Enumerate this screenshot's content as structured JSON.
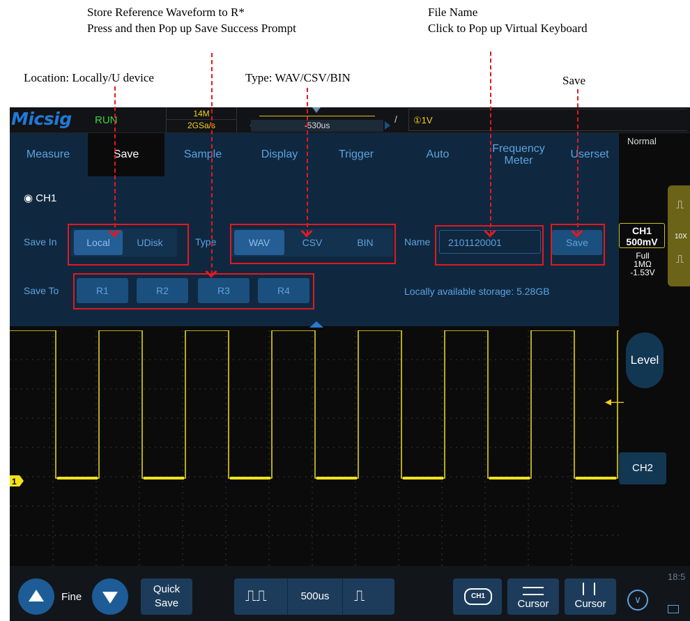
{
  "annotations": {
    "store_ref_line1": "Store Reference Waveform to R*",
    "store_ref_line2": "Press and then Pop up Save Success Prompt",
    "file_name_line1": "File Name",
    "file_name_line2": "Click to Pop up Virtual Keyboard",
    "location": "Location: Locally/U device",
    "type": "Type: WAV/CSV/BIN",
    "save": "Save"
  },
  "topbar": {
    "logo": "Micsig",
    "run_status": "RUN",
    "memory_depth": "14M",
    "sample_rate": "2GSa/s",
    "timebase_offset": "-530us",
    "trigger_level": "①1V"
  },
  "menu": {
    "items": [
      "Measure",
      "Save",
      "Sample",
      "Display",
      "Trigger",
      "Auto"
    ],
    "freq_meter_line1": "Frequency",
    "freq_meter_line2": "Meter",
    "userset": "Userset"
  },
  "save_panel": {
    "channel": "CH1",
    "save_in_label": "Save In",
    "save_in_options": [
      "Local",
      "UDisk"
    ],
    "type_label": "Type",
    "type_options": [
      "WAV",
      "CSV",
      "BIN"
    ],
    "name_label": "Name",
    "name_value": "2101120001",
    "save_button": "Save",
    "save_to_label": "Save To",
    "save_to_options": [
      "R1",
      "R2",
      "R3",
      "R4"
    ],
    "storage_text": "Locally available storage:  5.28GB"
  },
  "right_panel": {
    "mode": "Normal",
    "ch1_label": "CH1",
    "ch1_scale": "500mV",
    "ch1_bw": "Full",
    "ch1_impedance": "1MΩ",
    "ch1_offset": "-1.53V",
    "probe": "10X",
    "level_button": "Level",
    "ch2_button": "CH2"
  },
  "waveform": {
    "channel_marker": "1",
    "color": "#f2e21a"
  },
  "bottom": {
    "fine": "Fine",
    "quick_save_line1": "Quick",
    "quick_save_line2": "Save",
    "timebase": "500us",
    "ch1_icon": "CH1",
    "cursor1": "Cursor",
    "cursor2": "Cursor",
    "time": "18:5"
  }
}
